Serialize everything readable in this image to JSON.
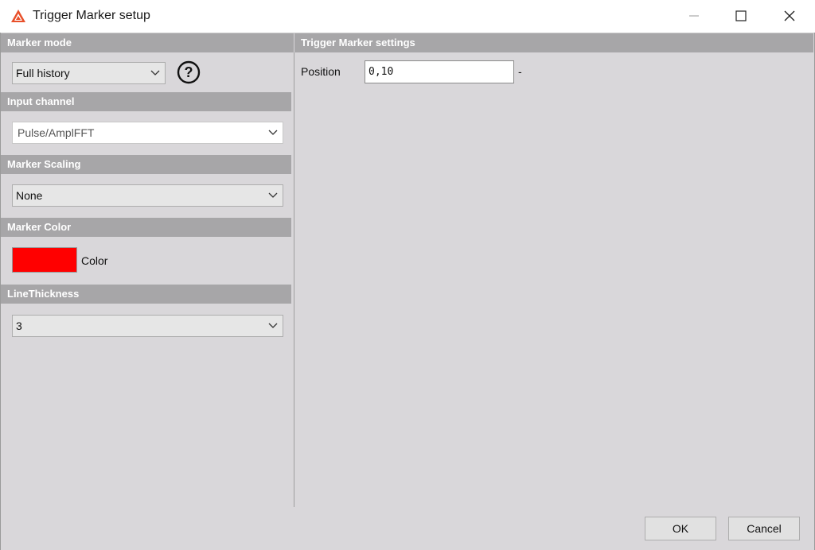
{
  "window": {
    "title": "Trigger Marker setup",
    "icon": "app-logo-icon",
    "controls": [
      "minimize-icon",
      "maximize-icon",
      "close-icon"
    ]
  },
  "left_panel": {
    "marker_mode": {
      "header": "Marker mode",
      "selected": "Full history",
      "help_icon": "help-icon"
    },
    "input_channel": {
      "header": "Input channel",
      "selected": "Pulse/AmplFFT"
    },
    "marker_scaling": {
      "header": "Marker Scaling",
      "selected": "None"
    },
    "marker_color": {
      "header": "Marker Color",
      "swatch_color": "#ff0000",
      "label": "Color"
    },
    "line_thickness": {
      "header": "LineThickness",
      "selected": "3"
    }
  },
  "right_panel": {
    "header": "Trigger Marker settings",
    "position": {
      "label": "Position",
      "value": "0,10",
      "unit": "-"
    }
  },
  "footer": {
    "ok_label": "OK",
    "cancel_label": "Cancel"
  },
  "colors": {
    "section_header_bg": "#a7a6a8",
    "panel_bg": "#d9d7da",
    "accent_red": "#ff0000"
  }
}
